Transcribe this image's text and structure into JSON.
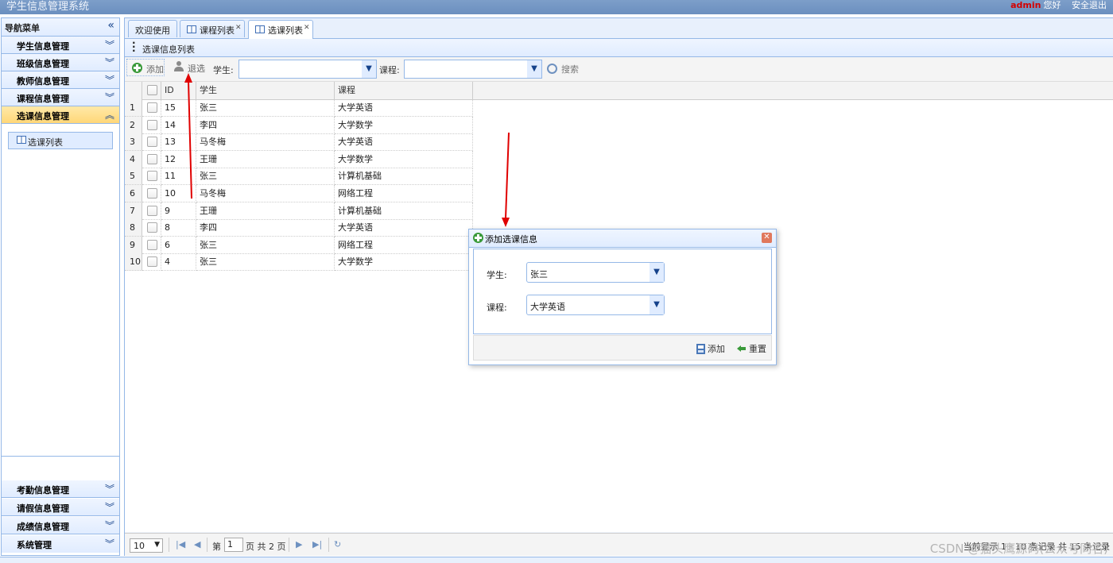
{
  "app": {
    "title": "学生信息管理系统",
    "user": "admin",
    "greeting": "您好",
    "logout": "安全退出"
  },
  "sidebar": {
    "title": "导航菜单",
    "top_items": [
      {
        "label": "学生信息管理"
      },
      {
        "label": "班级信息管理"
      },
      {
        "label": "教师信息管理"
      },
      {
        "label": "课程信息管理"
      },
      {
        "label": "选课信息管理",
        "active": true
      }
    ],
    "active_link": "选课列表",
    "bottom_items": [
      {
        "label": "考勤信息管理"
      },
      {
        "label": "请假信息管理"
      },
      {
        "label": "成绩信息管理"
      },
      {
        "label": "系统管理"
      }
    ]
  },
  "tabs": [
    {
      "label": "欢迎使用"
    },
    {
      "label": "课程列表"
    },
    {
      "label": "选课列表",
      "selected": true
    }
  ],
  "panel_title": "选课信息列表",
  "toolbar": {
    "add": "添加",
    "drop": "退选",
    "student_label": "学生:",
    "course_label": "课程:",
    "search": "搜索"
  },
  "grid": {
    "headers": {
      "id": "ID",
      "student": "学生",
      "course": "课程"
    },
    "rows": [
      {
        "n": "1",
        "id": "15",
        "student": "张三",
        "course": "大学英语"
      },
      {
        "n": "2",
        "id": "14",
        "student": "李四",
        "course": "大学数学"
      },
      {
        "n": "3",
        "id": "13",
        "student": "马冬梅",
        "course": "大学英语"
      },
      {
        "n": "4",
        "id": "12",
        "student": "王珊",
        "course": "大学数学"
      },
      {
        "n": "5",
        "id": "11",
        "student": "张三",
        "course": "计算机基础"
      },
      {
        "n": "6",
        "id": "10",
        "student": "马冬梅",
        "course": "网络工程"
      },
      {
        "n": "7",
        "id": "9",
        "student": "王珊",
        "course": "计算机基础"
      },
      {
        "n": "8",
        "id": "8",
        "student": "李四",
        "course": "大学英语"
      },
      {
        "n": "9",
        "id": "6",
        "student": "张三",
        "course": "网络工程"
      },
      {
        "n": "10",
        "id": "4",
        "student": "张三",
        "course": "大学数学"
      }
    ]
  },
  "pager": {
    "page_size": "10",
    "page_prefix": "第",
    "current_page": "1",
    "page_suffix": "页 共 2 页",
    "info": "当前显示 1 - 10 条记录 共 15 条记录"
  },
  "dialog": {
    "title": "添加选课信息",
    "student_label": "学生:",
    "student_value": "张三",
    "course_label": "课程:",
    "course_value": "大学英语",
    "add_button": "添加",
    "reset_button": "重置"
  },
  "colors": {
    "border": "#95b8e7",
    "active_menu": "#ffd778",
    "annotation_arrow": "#e00000",
    "user_name": "#d40000"
  },
  "watermark": "CSDN @猫头鹰源码(公众号同名)"
}
